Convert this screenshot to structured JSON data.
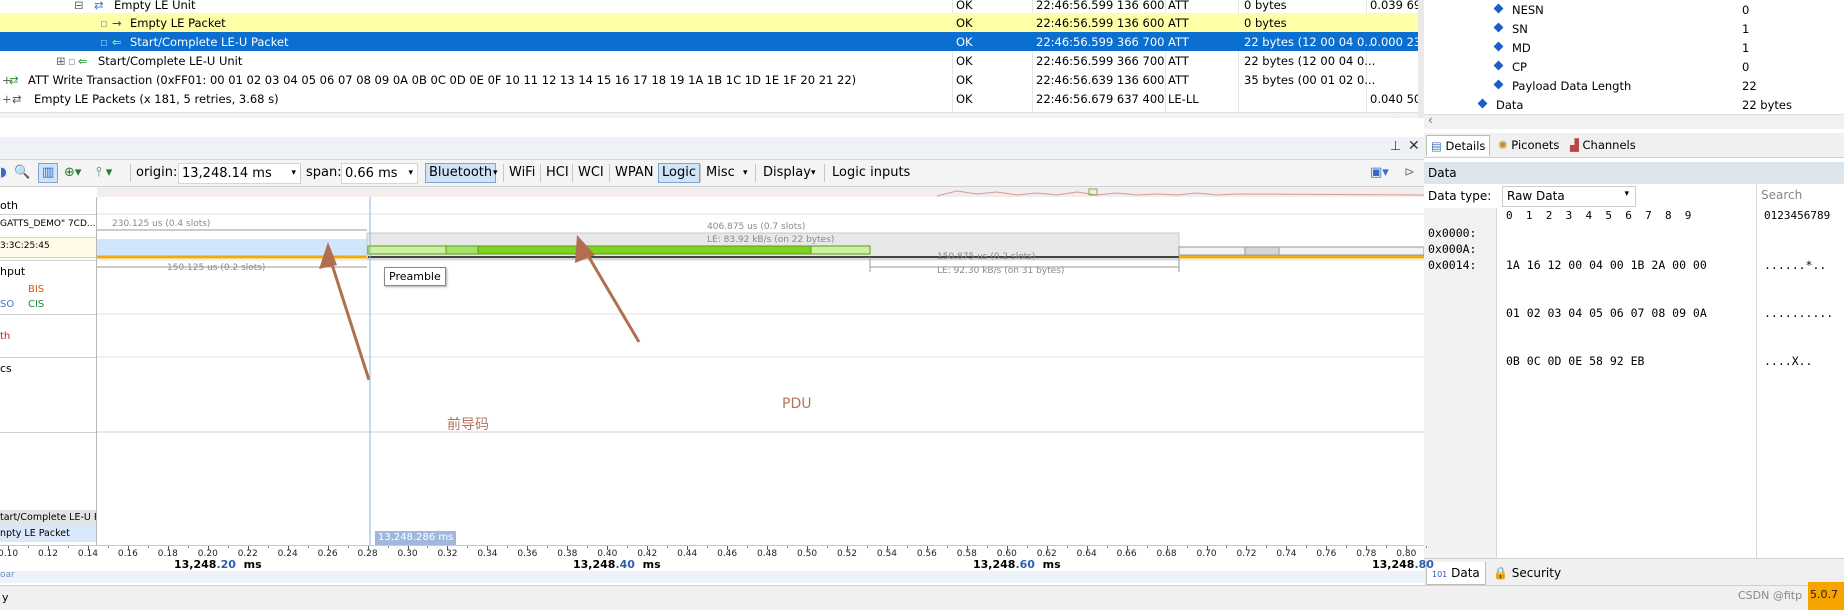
{
  "packet_list": {
    "rows": [
      {
        "name": "Empty LE Unit",
        "status": "OK",
        "time": "22:46:56.599 136 600",
        "proto": "ATT",
        "len": "0 bytes",
        "delta": "0.039 69"
      },
      {
        "name": "Empty LE Packet",
        "status": "OK",
        "time": "22:46:56.599 136 600",
        "proto": "ATT",
        "len": "0 bytes",
        "delta": ""
      },
      {
        "name": "Start/Complete LE-U Packet",
        "status": "OK",
        "time": "22:46:56.599 366 700",
        "proto": "ATT",
        "len": "22 bytes (12 00 04 0...",
        "delta": "0.000 23"
      },
      {
        "name": "Start/Complete LE-U Unit",
        "status": "OK",
        "time": "22:46:56.599 366 700",
        "proto": "ATT",
        "len": "22 bytes (12 00 04 0...",
        "delta": ""
      },
      {
        "name": "ATT Write Transaction (0xFF01: 00 01 02 03 04 05 06 07 08 09 0A 0B 0C 0D 0E 0F 10 11 12 13 14 15 16 17 18 19 1A 1B 1C 1D 1E 1F 20 21 22)",
        "status": "OK",
        "time": "22:46:56.639 136 600",
        "proto": "ATT",
        "len": "35 bytes (00 01 02 0...",
        "delta": ""
      },
      {
        "name": "Empty LE Packets (x 181, 5 retries, 3.68 s)",
        "status": "OK",
        "time": "22:46:56.679 637 400",
        "proto": "LE-LL",
        "len": "",
        "delta": "0.040 50"
      }
    ]
  },
  "details": {
    "fields": [
      {
        "label": "NESN",
        "value": "0"
      },
      {
        "label": "SN",
        "value": "1"
      },
      {
        "label": "MD",
        "value": "1"
      },
      {
        "label": "CP",
        "value": "0"
      },
      {
        "label": "Payload Data Length",
        "value": "22"
      },
      {
        "label": "Data",
        "value": "22 bytes"
      }
    ],
    "tabs": [
      "Details",
      "Piconets",
      "Channels"
    ]
  },
  "hex": {
    "title": "Data",
    "data_type_label": "Data type:",
    "data_type_value": "Raw Data",
    "search_label": "Search",
    "columns": "0  1  2  3  4  5  6  7  8  9",
    "ascii_header": "0123456789",
    "rows": [
      {
        "offset": "0x0000:",
        "bytes": "1A 16 12 00 04 00 1B 2A 00 00",
        "ascii": "......*.."
      },
      {
        "offset": "0x000A:",
        "bytes": "01 02 03 04 05 06 07 08 09 0A",
        "ascii": ".........."
      },
      {
        "offset": "0x0014:",
        "bytes": "0B 0C 0D 0E 58 92 EB",
        "ascii": "....X.."
      }
    ],
    "bottom_tabs": [
      "Data",
      "Security"
    ]
  },
  "toolbar": {
    "origin_label": "origin:",
    "origin_value": "13,248.14 ms",
    "span_label": "span:",
    "span_value": "0.66 ms",
    "items": [
      "Bluetooth",
      "WiFi",
      "HCI",
      "WCI",
      "WPAN",
      "Logic",
      "Misc",
      "Display",
      "Logic inputs"
    ]
  },
  "left_labels": {
    "bt": "oth",
    "device": "GATTS_DEMO\" 7CD...",
    "addr": "3:3C:25:45",
    "throughput": "hput",
    "bis": "BIS",
    "cis": "CIS",
    "iso": "SO",
    "th": "th",
    "cs": "cs",
    "sel1": "tart/Complete LE-U P...",
    "sel2": "npty LE Packet"
  },
  "timeline": {
    "top_dur": "230.125 us  (0.4 slots)",
    "pkt_dur": "406.875 us  (0.7 slots)",
    "pkt_rate": "LE:  83.92 kB/s  (on 22 bytes)",
    "gap_dur": "150.875 us  (0.2 slots)",
    "gap_rate": "LE:  92.30 kB/s  (on 31 bytes)",
    "low_dur": "150.125 us  (0.2 slots)",
    "tooltip": "Preamble",
    "anno_preamble": "前导码",
    "anno_pdu": "PDU",
    "cursor": "13,248.286 ms"
  },
  "ruler": {
    "ticks": [
      "0.10",
      "0.12",
      "0.14",
      "0.16",
      "0.18",
      "0.20",
      "0.22",
      "0.24",
      "0.26",
      "0.28",
      "0.30",
      "0.32",
      "0.34",
      "0.36",
      "0.38",
      "0.40",
      "0.42",
      "0.44",
      "0.46",
      "0.48",
      "0.50",
      "0.52",
      "0.54",
      "0.56",
      "0.58",
      "0.60",
      "0.62",
      "0.64",
      "0.66",
      "0.68",
      "0.70",
      "0.72",
      "0.74",
      "0.76",
      "0.78",
      "0.80"
    ],
    "majors": [
      {
        "a": "13,248",
        "b": ".20",
        "u": "ms"
      },
      {
        "a": "13,248",
        "b": ".40",
        "u": "ms"
      },
      {
        "a": "13,248",
        "b": ".60",
        "u": "ms"
      },
      {
        "a": "13,248",
        "b": ".80",
        "u": ""
      }
    ]
  },
  "status": {
    "left": "y",
    "watermark": "CSDN @fitp",
    "badge": "5.0.7"
  }
}
